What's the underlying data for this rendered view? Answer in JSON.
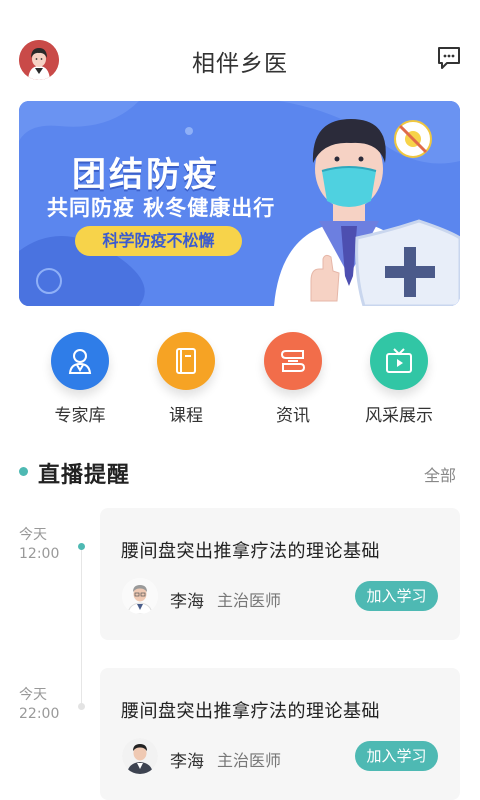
{
  "header": {
    "title": "相伴乡医",
    "avatar_icon": "user-avatar-icon",
    "message_icon": "chat-bubble-icon"
  },
  "banner": {
    "title": "团结防疫",
    "subtitle": "共同防疫 秋冬健康出行",
    "pill": "科学防疫不松懈"
  },
  "menu": {
    "items": [
      {
        "label": "专家库",
        "icon": "expert-icon",
        "color": "#2f7de8"
      },
      {
        "label": "课程",
        "icon": "book-icon",
        "color": "#f6a324"
      },
      {
        "label": "资讯",
        "icon": "news-icon",
        "color": "#f26d4a"
      },
      {
        "label": "风采展示",
        "icon": "tv-icon",
        "color": "#31c6a5"
      }
    ]
  },
  "live": {
    "title": "直播提醒",
    "more": "全部",
    "items": [
      {
        "day": "今天",
        "time": "12:00",
        "title": "腰间盘突出推拿疗法的理论基础",
        "doctor": "李海",
        "role": "主治医师",
        "button": "加入学习"
      },
      {
        "day": "今天",
        "time": "22:00",
        "title": "腰间盘突出推拿疗法的理论基础",
        "doctor": "李海",
        "role": "主治医师",
        "button": "加入学习"
      }
    ]
  },
  "colors": {
    "accent": "#4eb9b3",
    "banner_blue": "#5b86ee",
    "pill_yellow": "#f7d34a"
  }
}
